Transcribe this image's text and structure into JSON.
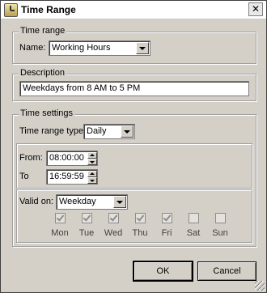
{
  "window": {
    "title": "Time Range",
    "close_symbol": "✕"
  },
  "time_range_group": {
    "legend": "Time range",
    "name_label": "Name:",
    "name_value": "Working Hours"
  },
  "description_group": {
    "legend": "Description",
    "value": "Weekdays from 8 AM to 5 PM"
  },
  "time_settings_group": {
    "legend": "Time settings",
    "type_label": "Time range type:",
    "type_value": "Daily",
    "from_label": "From:",
    "from_value": "08:00:00",
    "to_label": "To",
    "to_value": "16:59:59",
    "valid_on_label": "Valid on:",
    "valid_on_value": "Weekday",
    "days": [
      {
        "label": "Mon",
        "checked": true
      },
      {
        "label": "Tue",
        "checked": true
      },
      {
        "label": "Wed",
        "checked": true
      },
      {
        "label": "Thu",
        "checked": true
      },
      {
        "label": "Fri",
        "checked": true
      },
      {
        "label": "Sat",
        "checked": false
      },
      {
        "label": "Sun",
        "checked": false
      }
    ]
  },
  "buttons": {
    "ok_label": "OK",
    "cancel_label": "Cancel"
  }
}
